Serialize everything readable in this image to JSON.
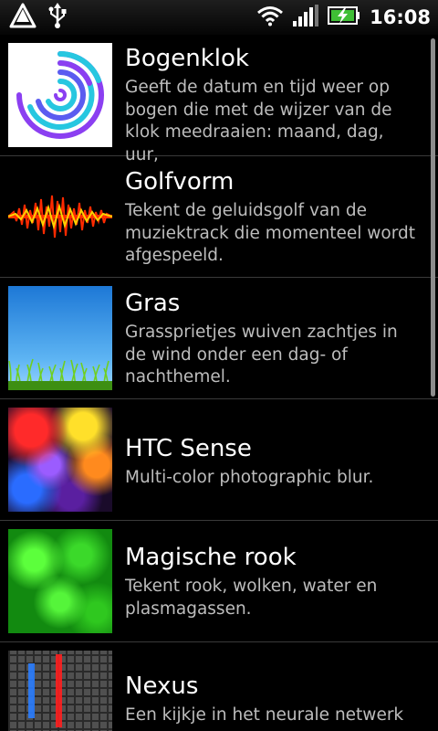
{
  "status_bar": {
    "time": "16:08",
    "left_icons": [
      "warning-icon",
      "usb-icon"
    ],
    "right_icons": [
      "wifi-icon",
      "signal-icon",
      "battery-charging-icon"
    ]
  },
  "wallpapers": [
    {
      "title": "Bogenklok",
      "description": "Geeft de datum en tijd weer op bogen die met de wijzer van de klok meedraaien: maand, dag, uur,"
    },
    {
      "title": "Golfvorm",
      "description": "Tekent de geluidsgolf van de muziektrack die momenteel wordt afgespeeld."
    },
    {
      "title": "Gras",
      "description": "Grassprietjes wuiven zachtjes in de wind onder een dag- of nachthemel."
    },
    {
      "title": "HTC Sense",
      "description": "Multi-color photographic blur."
    },
    {
      "title": "Magische rook",
      "description": "Tekent rook, wolken, water en plasmagassen."
    },
    {
      "title": "Nexus",
      "description": "Een kijkje in het neurale netwerk"
    }
  ]
}
